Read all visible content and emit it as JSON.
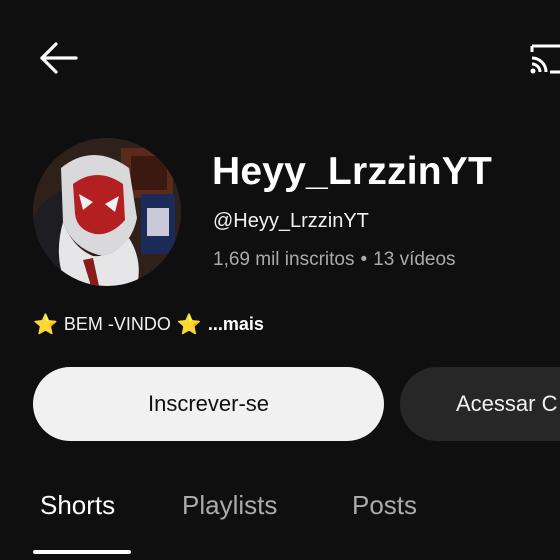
{
  "header": {
    "back_icon": "arrow-left-icon",
    "cast_icon": "cast-icon"
  },
  "channel": {
    "avatar": "avatar-image",
    "name": "Heyy_LrzzinYT",
    "handle": "@Heyy_LrzzinYT",
    "subscribers": "1,69 mil inscritos",
    "separator": "•",
    "videos": "13 vídeos"
  },
  "description": {
    "star": "⭐",
    "text": "BEM -VINDO",
    "more": "...mais"
  },
  "actions": {
    "subscribe_label": "Inscrever-se",
    "access_label": "Acessar C"
  },
  "tabs": [
    {
      "label": "Shorts",
      "active": true
    },
    {
      "label": "Playlists",
      "active": false
    },
    {
      "label": "Posts",
      "active": false
    }
  ],
  "colors": {
    "background": "#0f0f0f",
    "text": "#ffffff",
    "secondary_text": "#aaaaaa",
    "subscribe_bg": "#f1f1f1",
    "access_bg": "#272727"
  }
}
